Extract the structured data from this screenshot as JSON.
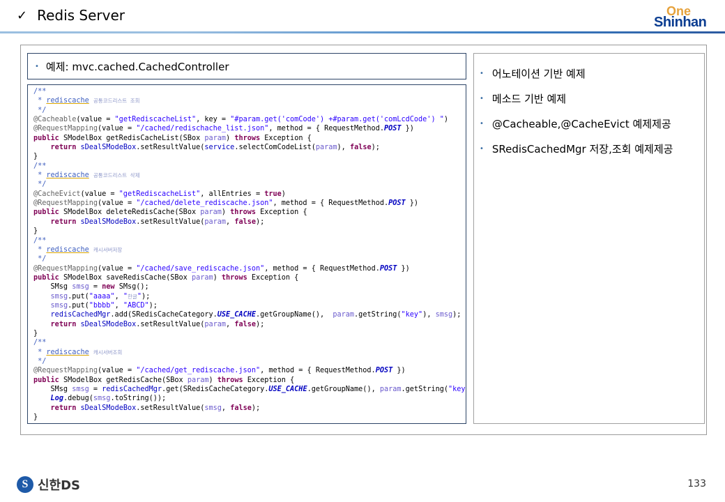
{
  "header": {
    "check_glyph": "✓",
    "title": "Redis Server"
  },
  "logo": {
    "top": "One",
    "bottom": "Shinhan"
  },
  "example": {
    "bullet": "•",
    "label": "예제: mvc.cached.CachedController"
  },
  "right_items": [
    "어노테이션 기반 예제",
    "메소드 기반 예제",
    "@Cacheable,@CacheEvict  예제제공",
    "SRedisCachedMgr   저장,조회 예제제공"
  ],
  "footer": {
    "logo_text": "신한DS",
    "page_number": "133"
  },
  "colors": {
    "accent": "#2c5aa0",
    "logo_orange": "#e6a23c",
    "logo_navy": "#0b3d91"
  }
}
